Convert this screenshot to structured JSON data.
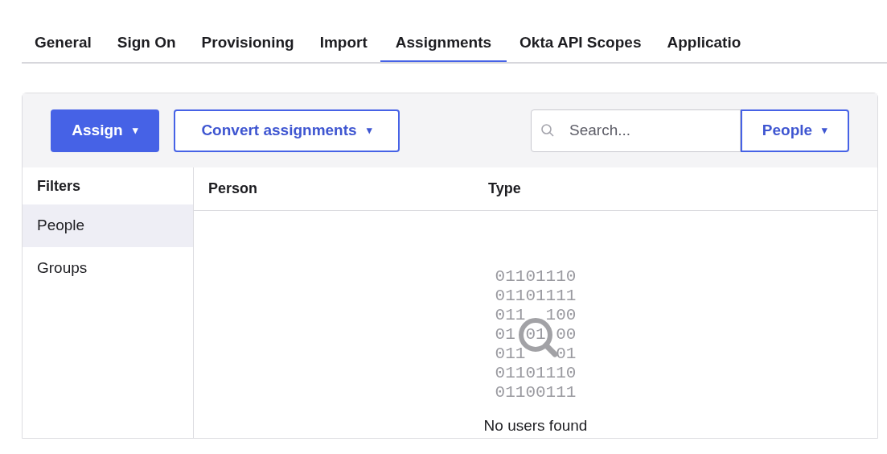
{
  "tabs": [
    {
      "label": "General",
      "selected": false
    },
    {
      "label": "Sign On",
      "selected": false
    },
    {
      "label": "Provisioning",
      "selected": false
    },
    {
      "label": "Import",
      "selected": false
    },
    {
      "label": "Assignments",
      "selected": true
    },
    {
      "label": "Okta API Scopes",
      "selected": false
    },
    {
      "label": "Applicatio",
      "selected": false
    }
  ],
  "toolbar": {
    "assign_button": {
      "label": "Assign",
      "caret": "▾"
    },
    "convert_button": {
      "label": "Convert assignments",
      "caret": "▾"
    },
    "search": {
      "placeholder": "Search..."
    },
    "type_dropdown": {
      "value": "People",
      "caret": "▾"
    }
  },
  "filters": {
    "title": "Filters",
    "items": [
      {
        "label": "People",
        "selected": true
      },
      {
        "label": "Groups",
        "selected": false
      }
    ]
  },
  "table": {
    "columns": [
      "Person",
      "Type"
    ]
  },
  "empty_state": {
    "binary_lines": [
      "01101110",
      "01101111",
      "011  100",
      "01 01 00",
      "011   01",
      "01101110",
      "01100111"
    ],
    "message": "No users found"
  }
}
